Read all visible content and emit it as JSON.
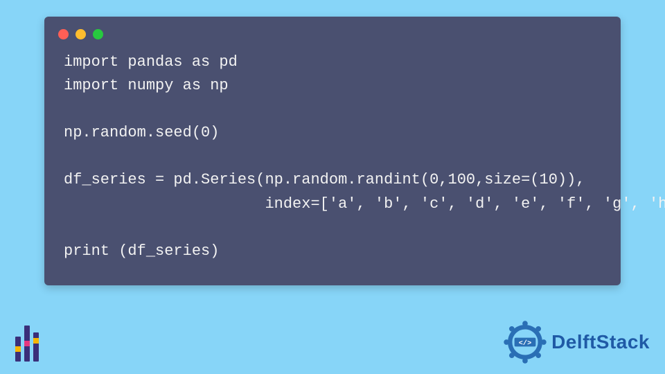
{
  "window": {
    "controls": [
      "red",
      "yellow",
      "green"
    ]
  },
  "code": {
    "lines": [
      "import pandas as pd",
      "import numpy as np",
      "",
      "np.random.seed(0)",
      "",
      "df_series = pd.Series(np.random.randint(0,100,size=(10)),",
      "                      index=['a', 'b', 'c', 'd', 'e', 'f', 'g', 'h', 'i', 'j'])",
      "",
      "print (df_series)"
    ]
  },
  "branding": {
    "name": "DelftStack",
    "badge_symbol": "</>"
  },
  "colors": {
    "background": "#87d5f8",
    "window_bg": "#4a5070",
    "code_text": "#f2f2f2",
    "brand_blue": "#1f5aa6"
  }
}
